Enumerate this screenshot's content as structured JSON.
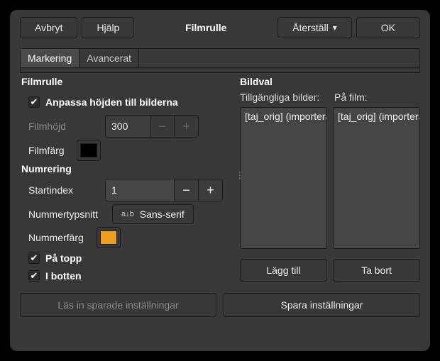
{
  "header": {
    "cancel": "Avbryt",
    "help": "Hjälp",
    "title": "Filmrulle",
    "reset": "Återställ",
    "ok": "OK"
  },
  "tabs": {
    "selection": "Markering",
    "advanced": "Avancerat"
  },
  "film": {
    "section": "Filmrulle",
    "fit_height": "Anpassa höjden till bilderna",
    "film_height_label": "Filmhöjd",
    "film_height_value": "300",
    "film_color_label": "Filmfärg",
    "film_color_value": "#000000"
  },
  "numbering": {
    "section": "Numrering",
    "start_index_label": "Startindex",
    "start_index_value": "1",
    "font_label": "Nummertypsnitt",
    "font_value": "Sans-serif",
    "color_label": "Nummerfärg",
    "color_value": "#f0a020",
    "on_top": "På topp",
    "on_bottom": "I botten"
  },
  "images": {
    "section": "Bildval",
    "available_label": "Tillgängliga bilder:",
    "on_film_label": "På film:",
    "available_item": "[taj_orig] (importerad)",
    "on_film_item": "[taj_orig] (importerad)",
    "add": "Lägg till",
    "remove": "Ta bort"
  },
  "footer": {
    "load": "Läs in sparade inställningar",
    "save": "Spara inställningar"
  }
}
